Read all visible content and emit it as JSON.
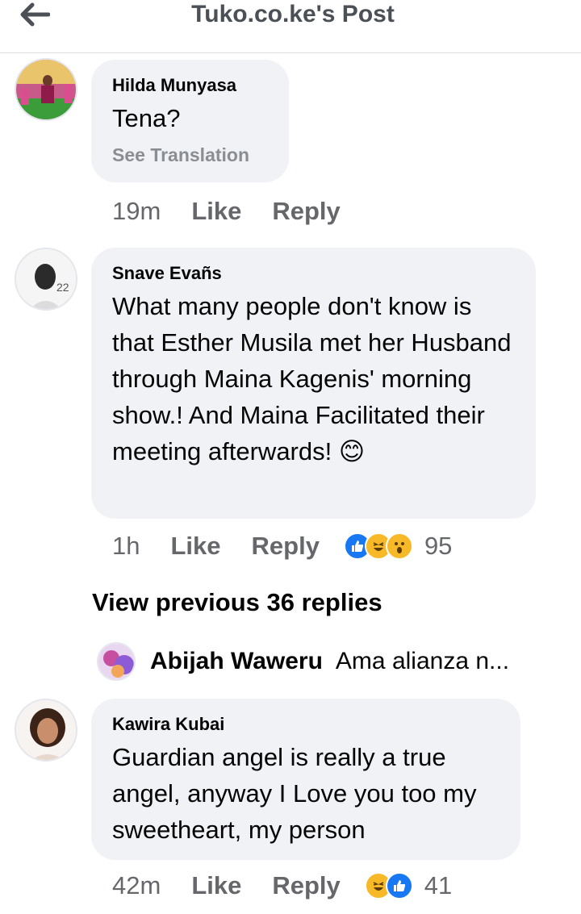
{
  "header": {
    "title": "Tuko.co.ke's Post",
    "back_icon": "arrow-left-icon"
  },
  "comments": [
    {
      "author": "Hilda Munyasa",
      "text": "Tena?",
      "see_translation": "See Translation",
      "time": "19m",
      "like": "Like",
      "reply": "Reply"
    },
    {
      "author": "Snave Evañs",
      "text": "What many people don't know is that Esther Musila met her Husband through Maina Kagenis' morning show.! And Maina Facilitated their meeting afterwards! 😊",
      "time": "1h",
      "like": "Like",
      "reply": "Reply",
      "reactions": [
        "like-reaction-icon",
        "haha-reaction-icon",
        "wow-reaction-icon"
      ],
      "reaction_count": "95"
    },
    {
      "author": "Kawira Kubai",
      "text": "Guardian angel is really a true angel, anyway I Love you too my sweetheart, my person",
      "time": "42m",
      "like": "Like",
      "reply": "Reply",
      "reactions": [
        "haha-reaction-icon",
        "like-reaction-icon"
      ],
      "reaction_count": "41"
    }
  ],
  "view_previous": "View previous 36 replies",
  "reply_preview": {
    "author": "Abijah Waweru",
    "text": "Ama alianza n..."
  },
  "colors": {
    "like_blue": "#1877f2",
    "emoji_yellow": "#f7b928",
    "bubble": "#f0f2f5",
    "meta_gray": "#65676b"
  }
}
